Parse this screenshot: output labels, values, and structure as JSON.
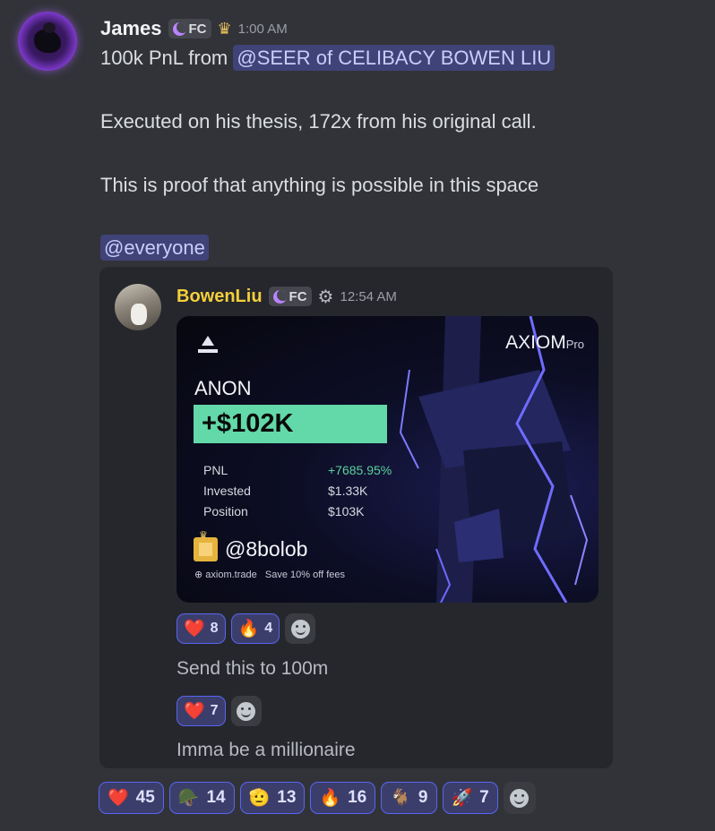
{
  "message": {
    "username": "James",
    "tag": "FC",
    "timestamp": "1:00 AM",
    "line1_prefix": "100k PnL from",
    "mention": "@SEER of CELIBACY BOWEN LIU",
    "line2": "Executed on his thesis, 172x from his original call.",
    "line3": "This is proof that anything is possible in this space",
    "everyone": "@everyone"
  },
  "embed": {
    "username": "BowenLiu",
    "tag": "FC",
    "timestamp": "12:54 AM",
    "card": {
      "brand": "AXIOM",
      "brand_suffix": "Pro",
      "ticker": "ANON",
      "pnl": "+$102K",
      "stats": [
        {
          "label": "PNL",
          "value": "+7685.95%"
        },
        {
          "label": "Invested",
          "value": "$1.33K"
        },
        {
          "label": "Position",
          "value": "$103K"
        }
      ],
      "handle": "@8bolob",
      "site": "⊕ axiom.trade",
      "promo": "Save 10% off fees"
    },
    "reactions1": [
      {
        "emoji": "❤️",
        "count": "8"
      },
      {
        "emoji": "🔥",
        "count": "4"
      }
    ],
    "text1": "Send this to 100m",
    "reactions2": [
      {
        "emoji": "❤️",
        "count": "7"
      }
    ],
    "text2": "Imma be a millionaire"
  },
  "reactions": [
    {
      "emoji": "❤️",
      "count": "45"
    },
    {
      "emoji": "🪖",
      "count": "14"
    },
    {
      "emoji": "🫡",
      "count": "13"
    },
    {
      "emoji": "🔥",
      "count": "16"
    },
    {
      "emoji": "🐐",
      "count": "9"
    },
    {
      "emoji": "🚀",
      "count": "7"
    }
  ],
  "colors": {
    "background": "#323339",
    "mention_bg": "#3f4378",
    "embed_username": "#f3cf3c",
    "pnl_box": "#63d8a8",
    "reaction_border": "#5865f2"
  }
}
